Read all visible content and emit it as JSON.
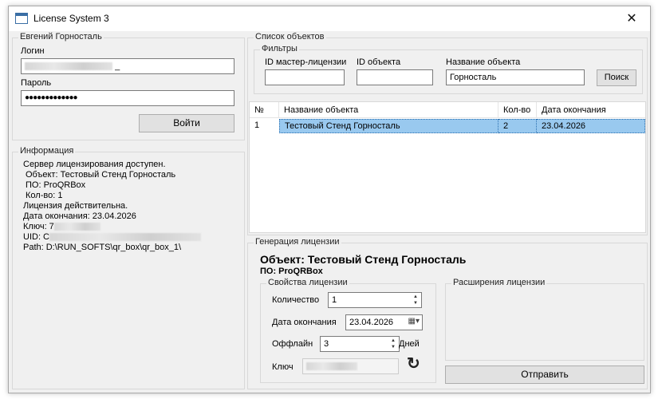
{
  "window": {
    "title": "License System 3",
    "close_glyph": "✕"
  },
  "user_panel": {
    "title": "Евгений Горносталь",
    "login_label": "Логин",
    "login_value": "_",
    "password_label": "Пароль",
    "password_value": "●●●●●●●●●●●●●",
    "login_button": "Войти"
  },
  "info_panel": {
    "title": "Информация",
    "lines": [
      "Сервер лицензирования доступен.",
      " Объект: Тестовый Стенд Горносталь",
      " ПО: ProQRBox",
      " Кол-во: 1",
      "Лицензия действительна.",
      "Дата окончания: 23.04.2026",
      "Ключ: 7",
      "UID: C",
      "Path: D:\\RUN_SOFTS\\qr_box\\qr_box_1\\"
    ]
  },
  "objects_panel": {
    "title": "Список объектов",
    "filters": {
      "title": "Фильтры",
      "master_license_label": "ID мастер-лицензии",
      "master_license_value": "",
      "object_id_label": "ID объекта",
      "object_id_value": "",
      "object_name_label": "Название объекта",
      "object_name_value": "Горносталь",
      "search_button": "Поиск"
    },
    "table": {
      "columns": [
        "№",
        "Название объекта",
        "Кол-во",
        "Дата окончания"
      ],
      "rows": [
        {
          "num": "1",
          "name": "Тестовый Стенд Горносталь",
          "count": "2",
          "end_date": "23.04.2026"
        }
      ]
    }
  },
  "generation_panel": {
    "title": "Генерация лицензии",
    "object_heading": "Объект: Тестовый Стенд Горносталь",
    "software_heading": "ПО: ProQRBox",
    "properties": {
      "title": "Свойства лицензии",
      "quantity_label": "Количество",
      "quantity_value": "1",
      "end_date_label": "Дата окончания",
      "end_date_value": "23.04.2026",
      "offline_label": "Оффлайн",
      "offline_value": "3",
      "offline_unit": "Дней",
      "key_label": "Ключ",
      "key_value": ""
    },
    "extensions_title": "Расширения лицензии",
    "send_button": "Отправить"
  },
  "icons": {
    "app": "window-icon",
    "refresh": "refresh-icon",
    "calendar": "calendar-icon"
  }
}
